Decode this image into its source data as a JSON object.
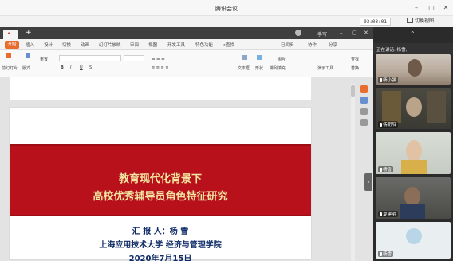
{
  "window": {
    "title": "腾讯会议",
    "timer": "03:03:01",
    "switch_view_label": "切换视图"
  },
  "wps": {
    "user": "手写",
    "start_tab": "开始",
    "ribbon_tabs": [
      "插入",
      "设计",
      "切换",
      "动画",
      "幻灯片放映",
      "审阅",
      "视图",
      "开发工具",
      "特色功能"
    ],
    "search_label": "查找",
    "sync_label": "已同步",
    "collab_label": "协作",
    "share_label": "分享",
    "ribbon_labels": {
      "from_current": "前幻灯片",
      "layout": "版式",
      "reset": "重置",
      "text_box": "文本框",
      "shape": "形状",
      "arrange": "排列",
      "picture": "图片",
      "fill": "填充",
      "present_tools": "演示工具",
      "replace": "替换",
      "find": "查找"
    }
  },
  "slide": {
    "title_line1": "教育现代化背景下",
    "title_line2": "高校优秀辅导员角色特征研究",
    "reporter": "汇 报 人：杨  雪",
    "affiliation": "上海应用技术大学  经济与管理学院",
    "date": "2020年7月15日"
  },
  "meeting": {
    "speaking_label": "正在讲话: 杨雪;",
    "participants": [
      {
        "name": "杨小强"
      },
      {
        "name": "杨朝阳"
      },
      {
        "name": "杨雪"
      },
      {
        "name": "夏建明"
      },
      {
        "name": "杨雪"
      }
    ]
  },
  "colors": {
    "banner_red": "#b8111c",
    "banner_text": "#f1e5a0",
    "body_text_blue": "#0d2a66",
    "wps_orange": "#e96b2d"
  }
}
